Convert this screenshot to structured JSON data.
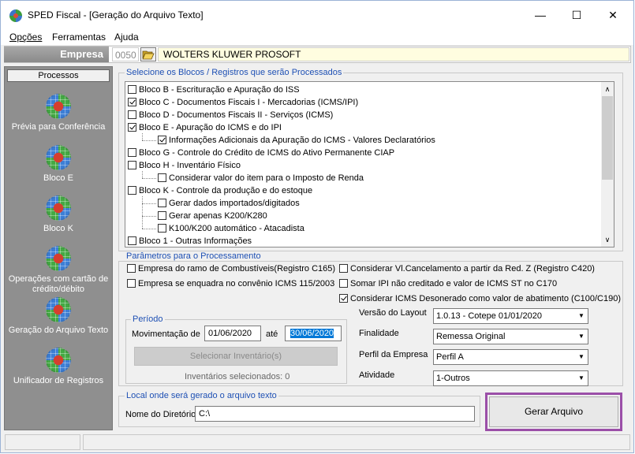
{
  "window": {
    "title": "SPED Fiscal - [Geração do Arquivo Texto]",
    "minimize": "—",
    "maximize": "☐",
    "close": "✕"
  },
  "menu": [
    "Opções",
    "Ferramentas",
    "Ajuda"
  ],
  "empresa": {
    "label": "Empresa",
    "code": "0050",
    "name": "WOLTERS KLUWER PROSOFT"
  },
  "sidebar": {
    "header": "Processos",
    "items": [
      {
        "label": "Prévia para Conferência",
        "icon": "globe-grid-icon"
      },
      {
        "label": "Bloco E",
        "icon": "globe-grid-icon"
      },
      {
        "label": "Bloco K",
        "icon": "globe-grid-icon"
      },
      {
        "label": "Operações com cartão de crédito/débito",
        "icon": "globe-grid-icon"
      },
      {
        "label": "Geração do Arquivo Texto",
        "icon": "globe-grid-icon"
      },
      {
        "label": "Unificador de Registros",
        "icon": "globe-grid-icon"
      }
    ]
  },
  "blocos": {
    "title": "Selecione os Blocos / Registros que serão Processados",
    "items": [
      {
        "label": "Bloco B - Escrituração e Apuração do ISS",
        "checked": false
      },
      {
        "label": "Bloco C - Documentos Fiscais I - Mercadorias (ICMS/IPI)",
        "checked": true
      },
      {
        "label": "Bloco D - Documentos Fiscais II - Serviços (ICMS)",
        "checked": false
      },
      {
        "label": "Bloco E - Apuração do ICMS e do IPI",
        "checked": true
      },
      {
        "label": "Informações Adicionais da Apuração do ICMS - Valores Declaratórios",
        "checked": true
      },
      {
        "label": "Bloco G - Controle do Crédito de ICMS do Ativo Permanente CIAP",
        "checked": false
      },
      {
        "label": "Bloco H - Inventário Físico",
        "checked": false
      },
      {
        "label": "Considerar valor do item para o Imposto de Renda",
        "checked": false
      },
      {
        "label": "Bloco K - Controle da produção e do estoque",
        "checked": false
      },
      {
        "label": "Gerar dados importados/digitados",
        "checked": false
      },
      {
        "label": "Gerar apenas K200/K280",
        "checked": false
      },
      {
        "label": "K100/K200 automático - Atacadista",
        "checked": false
      },
      {
        "label": "Bloco 1 - Outras Informações",
        "checked": false
      }
    ]
  },
  "params": {
    "title": "Parâmetros para o Processamento",
    "opt_combustiveis": {
      "label": "Empresa do ramo de Combustíveis(Registro C165)",
      "checked": false
    },
    "opt_convenio": {
      "label": "Empresa se enquadra no convênio ICMS 115/2003",
      "checked": false
    },
    "opt_cancelamento": {
      "label": "Considerar Vl.Cancelamento a partir da Red. Z (Registro C420)",
      "checked": false
    },
    "opt_ipi": {
      "label": "Somar IPI não creditado e valor de ICMS ST no C170",
      "checked": false
    },
    "opt_desonerado": {
      "label": "Considerar ICMS Desonerado como valor de abatimento (C100/C190)",
      "checked": true
    }
  },
  "periodo": {
    "title": "Período",
    "mov_label": "Movimentação de",
    "start": "01/06/2020",
    "ate_label": "até",
    "end": "30/06/2020",
    "inv_button": "Selecionar Inventário(s)",
    "inv_status": "Inventários selecionados: 0"
  },
  "layout": {
    "versao_label": "Versão do Layout",
    "versao_value": "1.0.13 - Cotepe 01/01/2020",
    "finalidade_label": "Finalidade",
    "finalidade_value": "Remessa Original",
    "perfil_label": "Perfil da Empresa",
    "perfil_value": "Perfil A",
    "atividade_label": "Atividade",
    "atividade_value": "1-Outros"
  },
  "local": {
    "title": "Local onde será gerado o arquivo texto",
    "dir_label": "Nome do Diretório",
    "dir_value": "C:\\"
  },
  "gerar_button": "Gerar Arquivo",
  "colors": {
    "highlight_border": "#9b4fa8",
    "group_label": "#1e50b4",
    "empresa_bg": "#fffde0"
  }
}
